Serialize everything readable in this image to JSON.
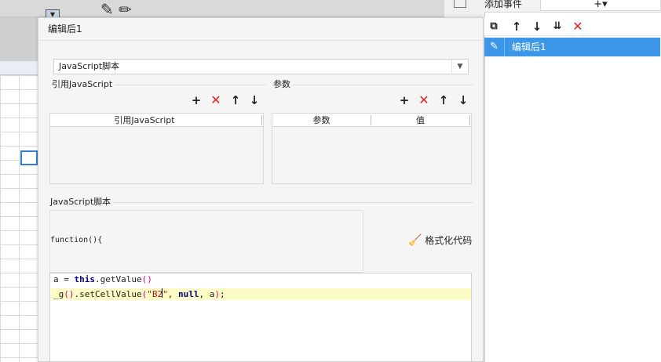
{
  "dialog": {
    "title": "编辑后1",
    "script_type": "JavaScript脚本",
    "ref_js": {
      "section_label": "引用JavaScript",
      "column_header": "引用JavaScript"
    },
    "params": {
      "section_label": "参数",
      "columns": [
        "参数",
        "值"
      ]
    },
    "script_section_label": "JavaScript脚本",
    "function_header": "function(){",
    "format_button": "格式化代码",
    "code": {
      "line1": {
        "a": "a = ",
        "kw": "this",
        "b": ".getValue",
        "p": "()"
      },
      "line2": {
        "a": "_g",
        "p1": "()",
        "b": ".setCellValue",
        "p2": "(",
        "s1": "\"B2",
        "s2": "\"",
        "c": ", ",
        "kw": "null",
        "d": ", a",
        "p3": ")",
        "e": ";"
      }
    }
  },
  "right_panel": {
    "title": "添加事件",
    "add_symbol": "+▾",
    "selected_event": "编辑后1"
  },
  "icons": {
    "toolbar": [
      "plus-icon",
      "delete-icon",
      "arrow-up-icon",
      "arrow-down-icon"
    ],
    "panel_toolbar": [
      "copy-icon",
      "arrow-up-icon",
      "arrow-down-icon",
      "move-bottom-icon",
      "delete-icon"
    ],
    "event_item": "pencil-icon",
    "format": "brush-icon"
  },
  "colors": {
    "accent": "#3d97e8",
    "delete": "#e02424",
    "line_highlight": "#fdfbc4",
    "keyword": "#000080",
    "string": "#a31515"
  }
}
